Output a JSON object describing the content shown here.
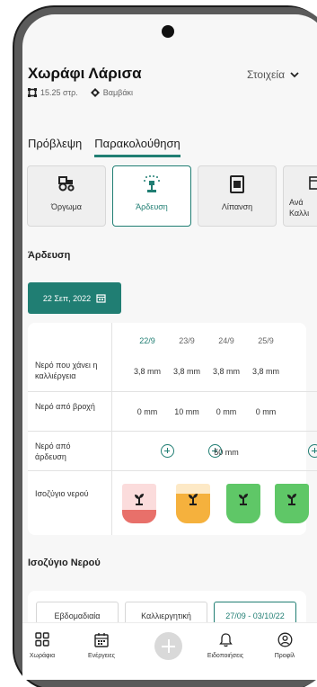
{
  "field": {
    "title": "Χωράφι Λάρισα",
    "details_label": "Στοιχεία",
    "area": "15.25 στρ.",
    "crop": "Βαμβάκι"
  },
  "tabs": [
    {
      "label": "Πρόβλεψη",
      "active": false
    },
    {
      "label": "Παρακολούθηση",
      "active": true
    }
  ],
  "categories": [
    {
      "label": "Όργωμα",
      "icon": "tractor-icon",
      "active": false
    },
    {
      "label": "Άρδευση",
      "icon": "sprinkler-icon",
      "active": true
    },
    {
      "label": "Λίπανση",
      "icon": "fertilizer-icon",
      "active": false
    },
    {
      "label": "Ανά\nΚαλλι",
      "icon": "calendar-icon",
      "active": false
    }
  ],
  "irrigation": {
    "section_title": "Άρδευση",
    "date_label": "22 Σεπ, 2022",
    "days": [
      "22/9",
      "23/9",
      "24/9",
      "25/9"
    ],
    "rows": [
      {
        "label": "Νερό που χάνει η καλλιέργεια",
        "values": [
          "3,8 mm",
          "3,8 mm",
          "3,8 mm",
          "3,8 mm"
        ]
      },
      {
        "label": "Νερό από βροχή",
        "values": [
          "0 mm",
          "10 mm",
          "0 mm",
          "0 mm"
        ]
      },
      {
        "label": "Νερό από άρδευση",
        "values": [
          "",
          "",
          "50 mm",
          ""
        ]
      },
      {
        "label": "Ισοζύγιο νερού",
        "values": []
      }
    ],
    "balance_levels": [
      {
        "fill_fraction": 0.35,
        "color": "#e8706a",
        "bg": "#fbdcdc"
      },
      {
        "fill_fraction": 0.75,
        "color": "#f5b13d",
        "bg": "#fde9c6"
      },
      {
        "fill_fraction": 1.0,
        "color": "#5fc767",
        "bg": "#d6f1d8"
      },
      {
        "fill_fraction": 1.0,
        "color": "#5fc767",
        "bg": "#d6f1d8"
      }
    ]
  },
  "water_balance": {
    "section_title": "Ισοζύγιο Νερού",
    "periods": [
      {
        "label": "Εβδομαδιαία",
        "active": false
      },
      {
        "label": "Καλλιεργητική",
        "active": false
      },
      {
        "label": "27/09 - 03/10/22",
        "active": true
      }
    ]
  },
  "nav": [
    {
      "label": "Χωράφια",
      "icon": "grid-icon"
    },
    {
      "label": "Ενέργειες",
      "icon": "calendar-icon"
    },
    {
      "label": "",
      "icon": "add-icon"
    },
    {
      "label": "Ειδοποιήσεις",
      "icon": "bell-icon"
    },
    {
      "label": "Προφίλ",
      "icon": "profile-icon"
    }
  ],
  "colors": {
    "accent": "#207e73",
    "danger": "#e8706a",
    "warning": "#f5b13d",
    "ok": "#5fc767"
  }
}
